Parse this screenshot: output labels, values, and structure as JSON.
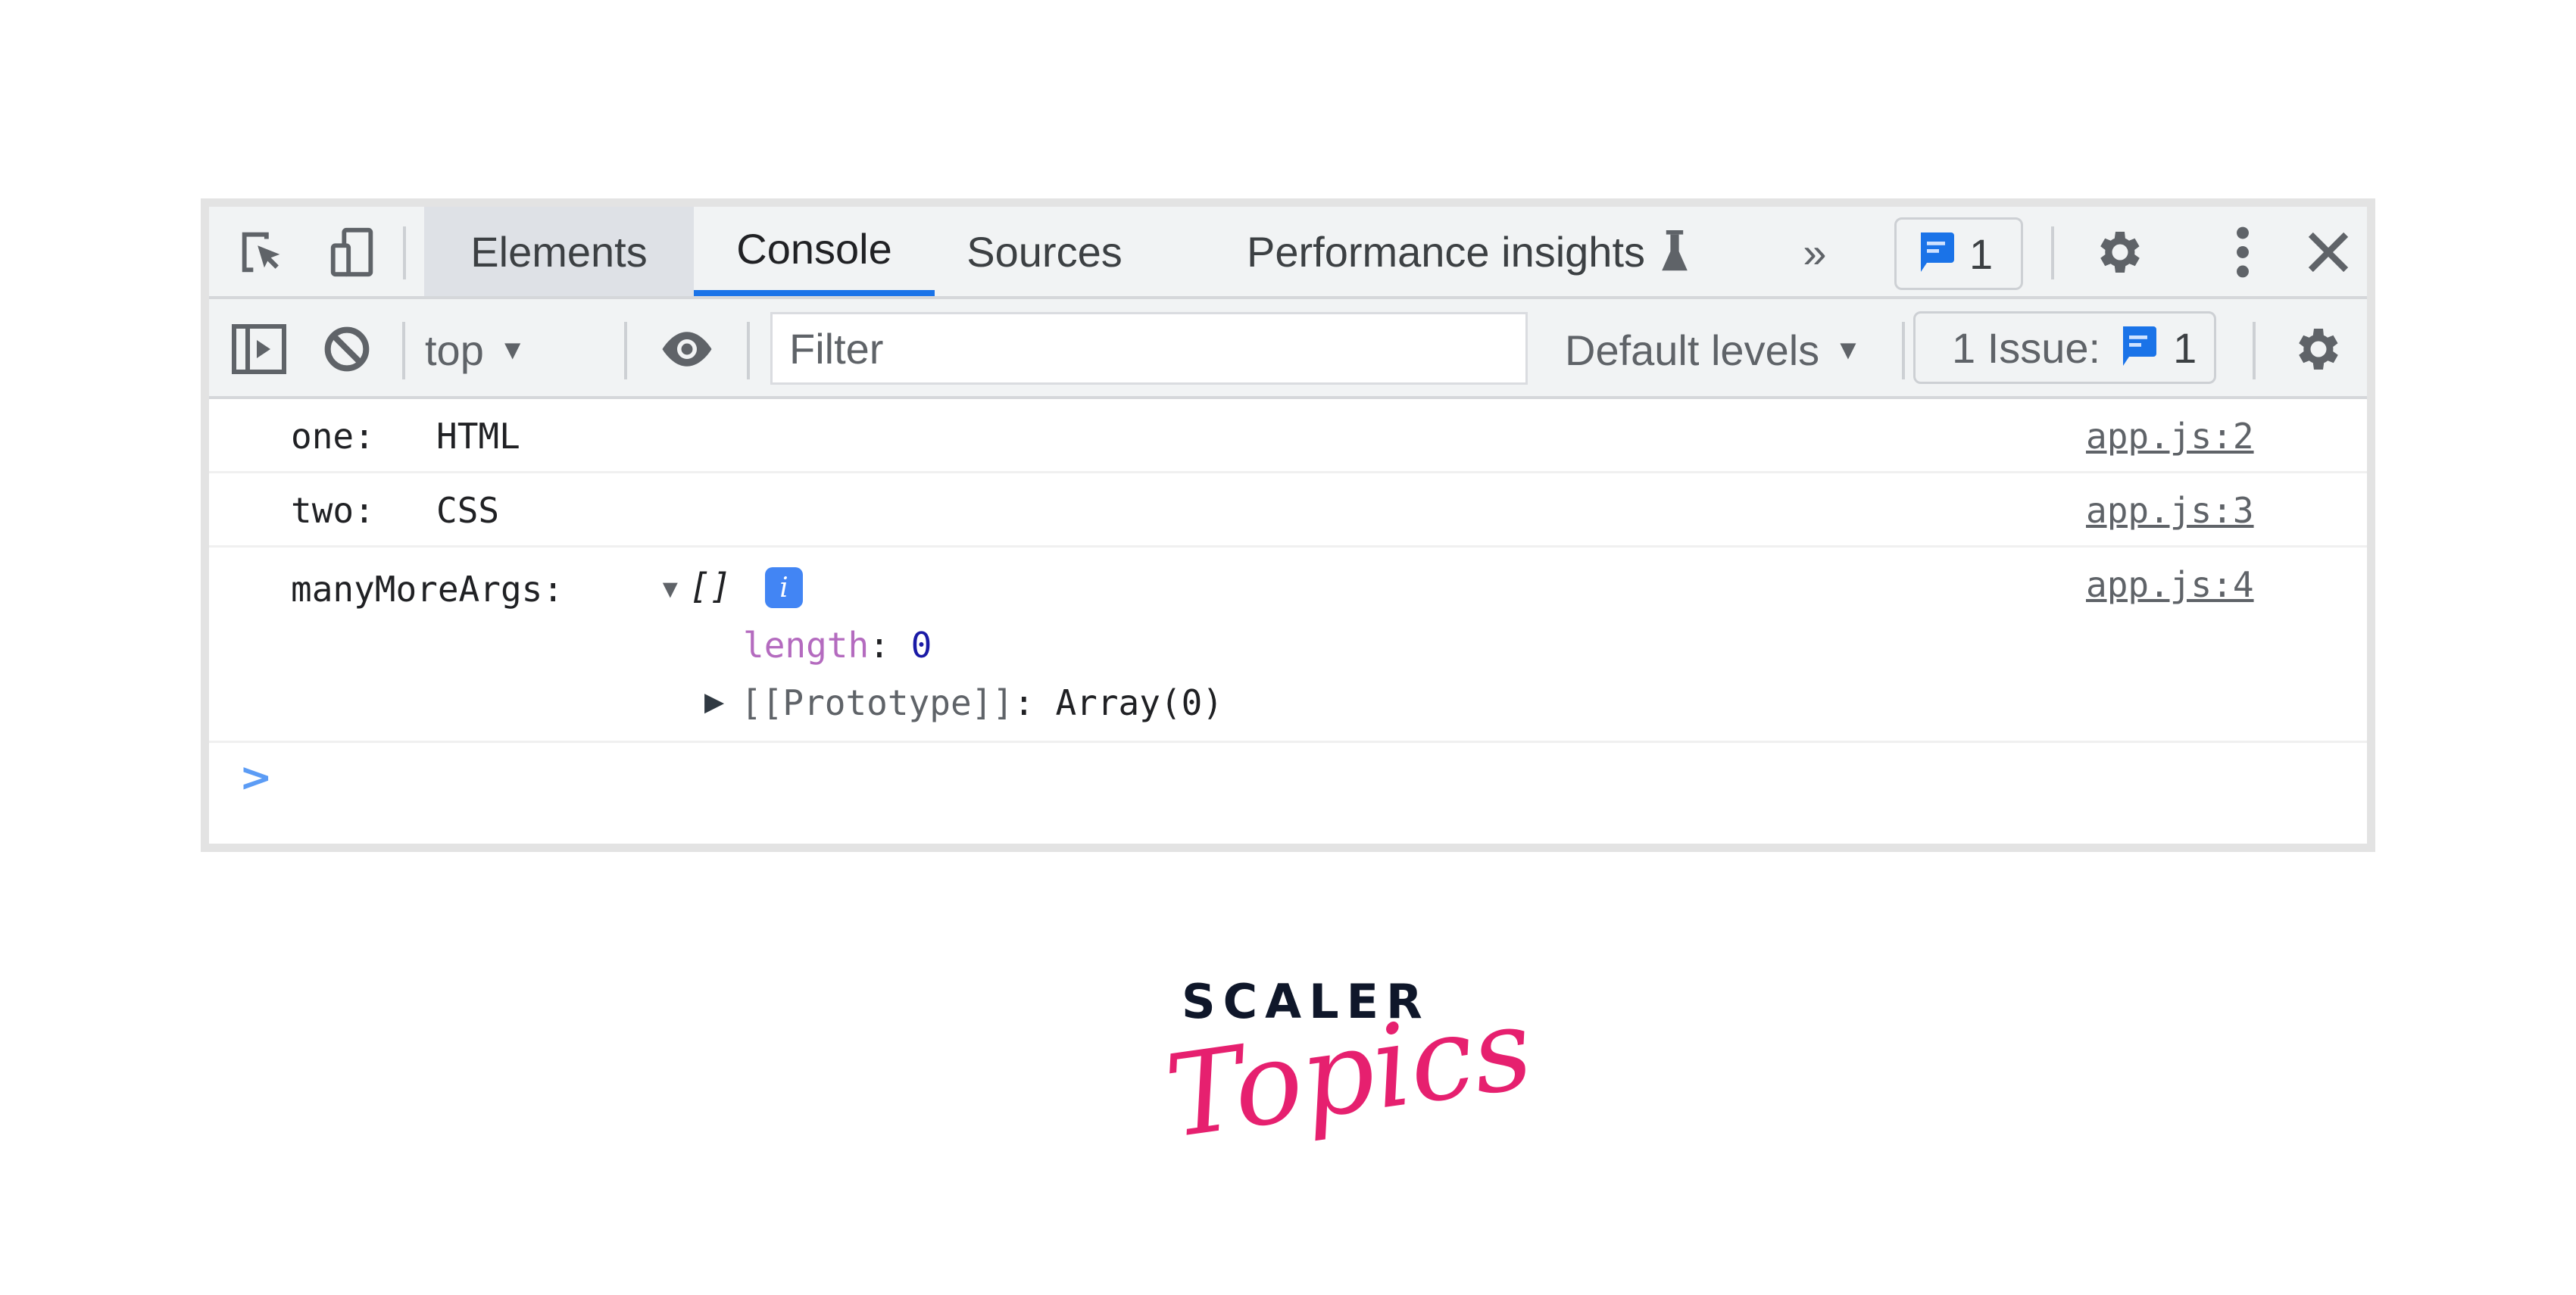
{
  "toolbar": {
    "icons": {
      "inspect": "inspect-element-icon",
      "device": "device-toolbar-icon",
      "more_tabs": "chevron-double-right-icon",
      "settings": "gear-icon",
      "menu": "kebab-menu-icon",
      "close": "close-icon"
    },
    "tabs": [
      {
        "label": "Elements",
        "active": false
      },
      {
        "label": "Console",
        "active": true
      },
      {
        "label": "Sources",
        "active": false
      },
      {
        "label": "Performance insights",
        "active": false,
        "experimental": true
      }
    ],
    "more_tabs_label": "»",
    "messages_count": "1"
  },
  "console_toolbar": {
    "context_label": "top",
    "filter_placeholder": "Filter",
    "levels_label": "Default levels",
    "issues_label": "1 Issue:",
    "issues_count": "1"
  },
  "console": {
    "rows": [
      {
        "label": "one:",
        "value": "HTML",
        "source": "app.js:2"
      },
      {
        "label": "two:",
        "value": "CSS",
        "source": "app.js:3"
      },
      {
        "label": "manyMoreArgs:",
        "value": "[]",
        "source": "app.js:4",
        "expanded": {
          "length_key": "length",
          "length_sep": ":",
          "length_value": "0",
          "prototype_label": "[[Prototype]]",
          "prototype_sep": ":",
          "prototype_value": "Array(0)"
        }
      }
    ],
    "prompt_symbol": ">"
  },
  "brand": {
    "top": "SCALER",
    "bottom": "Topics",
    "colors": {
      "dark": "#0f172a",
      "pink": "#e6206f"
    }
  },
  "colors": {
    "accent": "#1a73e8",
    "toolbar_bg": "#f1f3f4",
    "info_badge": "#4285f4"
  }
}
